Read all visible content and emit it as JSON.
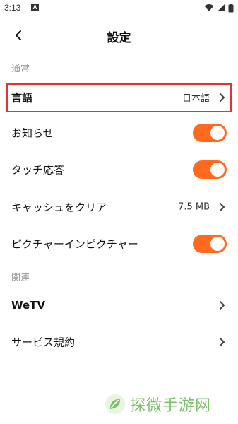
{
  "status_bar": {
    "time": "3:13",
    "notification_letter": "A"
  },
  "header": {
    "title": "設定"
  },
  "sections": {
    "general": "通常",
    "related": "関連"
  },
  "rows": {
    "language": {
      "label": "言語",
      "value": "日本語"
    },
    "notifications": {
      "label": "お知らせ",
      "enabled": true
    },
    "touch_response": {
      "label": "タッチ応答",
      "enabled": true
    },
    "clear_cache": {
      "label": "キャッシュをクリア",
      "value": "7.5 MB"
    },
    "pip": {
      "label": "ピクチャーインピクチャー",
      "enabled": true
    },
    "wetv": {
      "label": "WeTV"
    },
    "terms": {
      "label": "サービス規約"
    }
  },
  "watermark": {
    "text": "探微手游网"
  },
  "colors": {
    "accent": "#ff6a1f",
    "highlight": "#e0342c",
    "section_label": "#9a9a9a",
    "watermark": "#7cbf6a"
  }
}
